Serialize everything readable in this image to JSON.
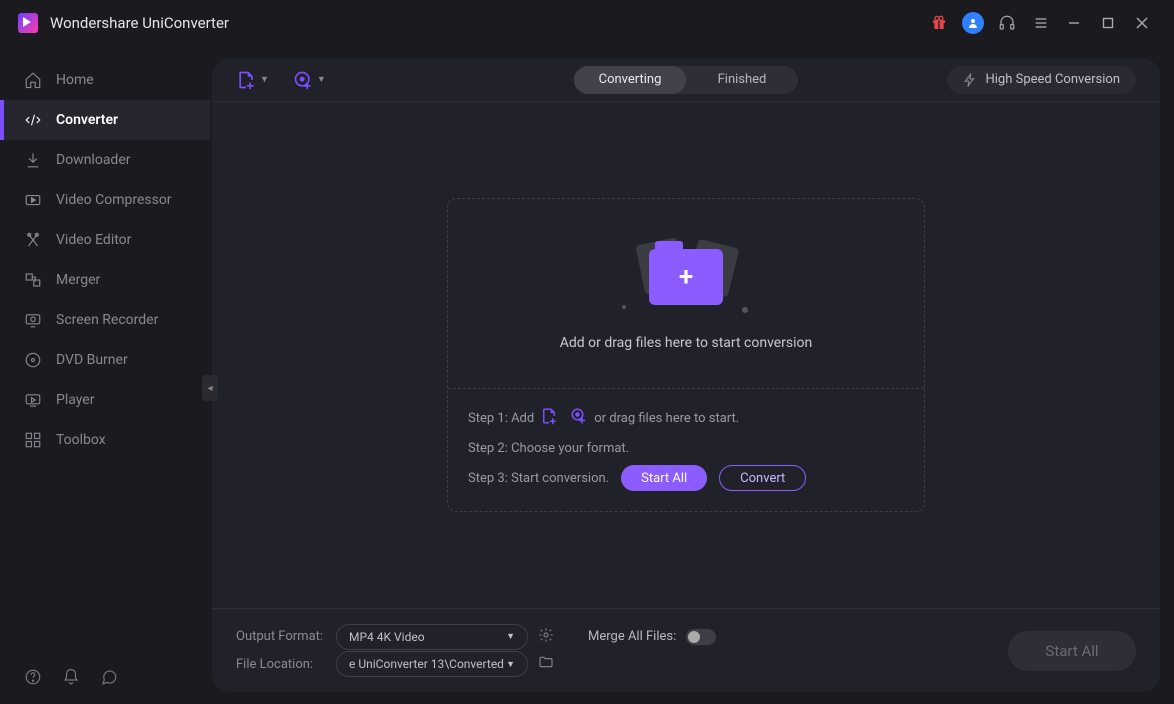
{
  "app": {
    "title": "Wondershare UniConverter"
  },
  "titlebar": {
    "gift": "gift-icon",
    "user": "user-icon",
    "support": "headset-icon",
    "menu": "menu-icon",
    "minimize": "minimize-icon",
    "maximize": "maximize-icon",
    "close": "close-icon"
  },
  "sidebar": {
    "items": [
      {
        "label": "Home",
        "icon": "home-icon"
      },
      {
        "label": "Converter",
        "icon": "converter-icon"
      },
      {
        "label": "Downloader",
        "icon": "downloader-icon"
      },
      {
        "label": "Video Compressor",
        "icon": "compressor-icon"
      },
      {
        "label": "Video Editor",
        "icon": "editor-icon"
      },
      {
        "label": "Merger",
        "icon": "merger-icon"
      },
      {
        "label": "Screen Recorder",
        "icon": "recorder-icon"
      },
      {
        "label": "DVD Burner",
        "icon": "dvd-icon"
      },
      {
        "label": "Player",
        "icon": "player-icon"
      },
      {
        "label": "Toolbox",
        "icon": "toolbox-icon"
      }
    ],
    "footer": {
      "help": "help-icon",
      "notify": "bell-icon",
      "feedback": "chat-icon"
    }
  },
  "toolbar": {
    "add_file": "add-file-icon",
    "add_disc": "add-disc-icon",
    "tabs": {
      "a": "Converting",
      "b": "Finished"
    },
    "hsc": "High Speed Conversion"
  },
  "drop": {
    "msg": "Add or drag files here to start conversion",
    "step1_pre": "Step 1: Add",
    "step1_post": "or drag files here to start.",
    "step2": "Step 2: Choose your format.",
    "step3": "Step 3: Start conversion.",
    "start_all": "Start All",
    "convert": "Convert"
  },
  "bottom": {
    "out_label": "Output Format:",
    "out_value": "MP4 4K Video",
    "loc_label": "File Location:",
    "loc_value": "e UniConverter 13\\Converted",
    "merge_label": "Merge All Files:",
    "start_all": "Start All"
  }
}
